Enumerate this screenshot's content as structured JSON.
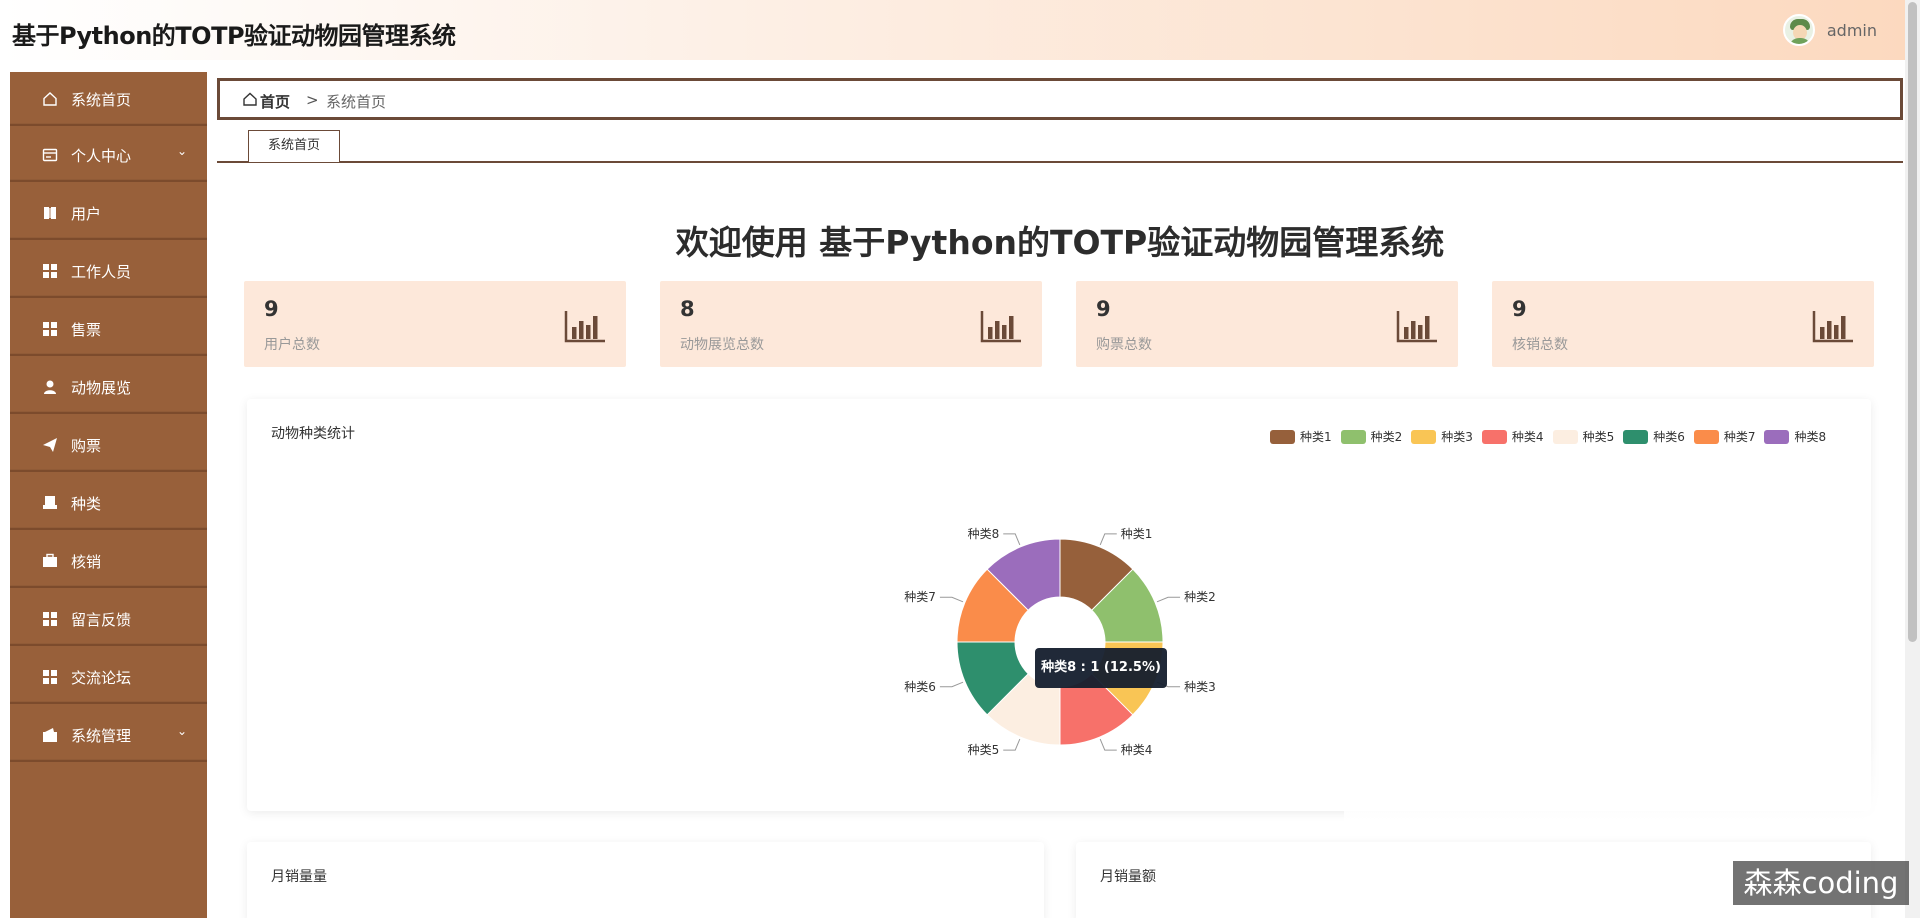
{
  "header": {
    "title": "基于Python的TOTP验证动物园管理系统",
    "user_name": "admin"
  },
  "sidebar": {
    "items": [
      {
        "label": "系统首页",
        "icon": "home-icon"
      },
      {
        "label": "个人中心",
        "icon": "id-card-icon",
        "expandable": true
      },
      {
        "label": "用户",
        "icon": "book-icon"
      },
      {
        "label": "工作人员",
        "icon": "grid-icon"
      },
      {
        "label": "售票",
        "icon": "grid-icon"
      },
      {
        "label": "动物展览",
        "icon": "person-icon"
      },
      {
        "label": "购票",
        "icon": "paper-plane-icon"
      },
      {
        "label": "种类",
        "icon": "printer-icon"
      },
      {
        "label": "核销",
        "icon": "briefcase-icon"
      },
      {
        "label": "留言反馈",
        "icon": "grid-icon"
      },
      {
        "label": "交流论坛",
        "icon": "grid-icon"
      },
      {
        "label": "系统管理",
        "icon": "wallet-icon",
        "expandable": true
      }
    ]
  },
  "breadcrumb": {
    "home": "首页",
    "separator": ">",
    "current": "系统首页"
  },
  "tabs": [
    {
      "label": "系统首页"
    }
  ],
  "welcome": "欢迎使用 基于Python的TOTP验证动物园管理系统",
  "stats": [
    {
      "value": "9",
      "label": "用户总数"
    },
    {
      "value": "8",
      "label": "动物展览总数"
    },
    {
      "value": "9",
      "label": "购票总数"
    },
    {
      "value": "9",
      "label": "核销总数"
    }
  ],
  "pie_card": {
    "title": "动物种类统计",
    "tooltip": "种类8 : 1 (12.5%)"
  },
  "chart_data": {
    "type": "pie",
    "title": "动物种类统计",
    "categories": [
      "种类1",
      "种类2",
      "种类3",
      "种类4",
      "种类5",
      "种类6",
      "种类7",
      "种类8"
    ],
    "values": [
      1,
      1,
      1,
      1,
      1,
      1,
      1,
      1
    ],
    "colors": [
      "#96603b",
      "#8fc06d",
      "#f9c555",
      "#f7716a",
      "#fceee1",
      "#2e8f6d",
      "#fa8c4a",
      "#9b6dbc"
    ],
    "donut": true,
    "legend": "top-right"
  },
  "bottom_cards": [
    {
      "title": "月销量量"
    },
    {
      "title": "月销量额"
    }
  ],
  "watermark": "森森coding",
  "colors": {
    "sidebar": "#98603a",
    "accent_border": "#6b4a38",
    "stat_card_bg": "#fde8da"
  }
}
